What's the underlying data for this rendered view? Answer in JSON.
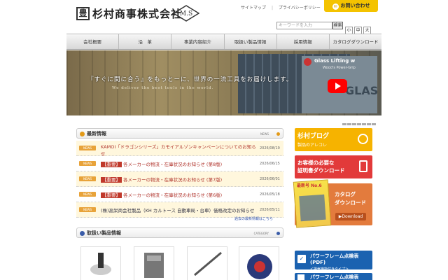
{
  "header": {
    "logo_char": "豊",
    "company": "杉村商事株式会社",
    "ms_mark": "M.S",
    "links": [
      "サイトマップ",
      "プライバシーポリシー"
    ],
    "contact": "お問い合わせ",
    "search_placeholder": "キーワードを入力",
    "search_button": "検索",
    "font_sizes": [
      "小",
      "中",
      "大"
    ]
  },
  "nav": [
    "会社概要",
    "沿　革",
    "事業内容紹介",
    "取扱い製品情報",
    "採用情報",
    "カタログダウンロード"
  ],
  "hero": {
    "catch": "『すぐに間に合う』をもっとーに、世界の一流工具をお届けします。",
    "sub": "We deliver the best tools in the world.",
    "video_title": "Glass Lifting w",
    "video_sub": "Wood's Power-Grip",
    "video_big": "GLASS"
  },
  "news": {
    "heading": "最新情報",
    "tag": "NEWS",
    "badge": "NEWS",
    "red_tag": "【重要】",
    "items": [
      {
        "title": "KAMOI「ドラゴンシリーズ」カモイアルゾンキャンペーンについてのお知らせ",
        "date": "2026/08/19"
      },
      {
        "title": "各メーカーの物流・在庫状況のお知らせ (第8版)",
        "date": "2026/06/15"
      },
      {
        "title": "各メーカーの物流・在庫状況のお知らせ (第7版)",
        "date": "2026/06/01"
      },
      {
        "title": "各メーカーの物流・在庫状況のお知らせ (第6版)",
        "date": "2026/05/18"
      },
      {
        "title": "(株)高栄商会社製品（KH カルトース 自動車局・台車）価格改定のお知らせ",
        "date": "2026/05/11"
      }
    ],
    "more": "過去の最新情報はこちら"
  },
  "products": {
    "heading": "取扱い製品情報",
    "tag": "CATEGORY"
  },
  "right": {
    "blog_title": "杉村ブログ",
    "blog_sub": "製品のアレコレ",
    "docs_line1": "お客様の必要な",
    "docs_line2": "証明書ダウンロード",
    "catalog_no": "最新号 No.6",
    "catalog_line1": "カタログ",
    "catalog_line2": "ダウンロード",
    "catalog_dl": "Download",
    "pf1_title": "パワーフレーム点検表(PDF)",
    "pf1_sub": "＜排気機能付きタイプ＞",
    "pf2_title": "パワーフレーム点検表(PDF)"
  }
}
